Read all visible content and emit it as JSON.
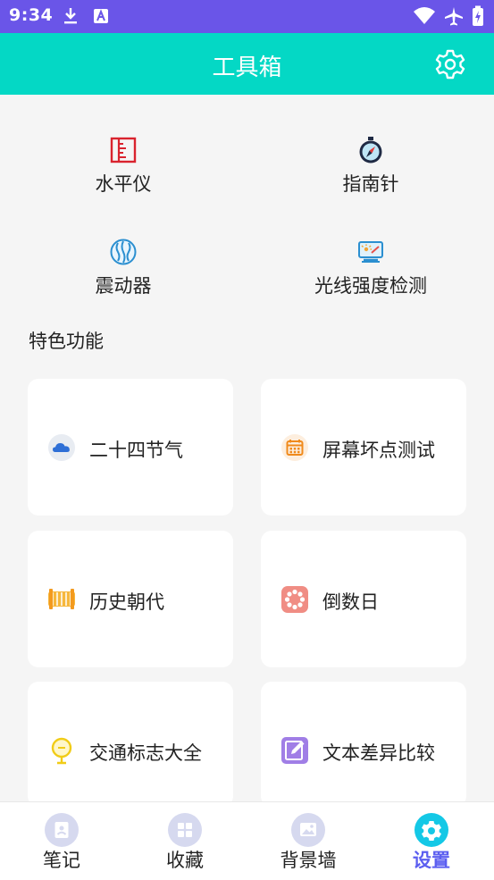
{
  "status_bar": {
    "time": "9:34"
  },
  "app_bar": {
    "title": "工具箱"
  },
  "tools": [
    {
      "label": "水平仪",
      "icon": "ruler-icon"
    },
    {
      "label": "指南针",
      "icon": "compass-icon"
    },
    {
      "label": "震动器",
      "icon": "vibration-icon"
    },
    {
      "label": "光线强度检测",
      "icon": "light-meter-icon"
    }
  ],
  "section": {
    "title": "特色功能"
  },
  "features": [
    {
      "label": "二十四节气",
      "icon": "cloud-icon"
    },
    {
      "label": "屏幕坏点测试",
      "icon": "calendar-grid-icon"
    },
    {
      "label": "历史朝代",
      "icon": "bamboo-scroll-icon"
    },
    {
      "label": "倒数日",
      "icon": "countdown-flower-icon"
    },
    {
      "label": "交通标志大全",
      "icon": "traffic-sign-icon"
    },
    {
      "label": "文本差异比较",
      "icon": "edit-note-icon"
    }
  ],
  "bottom_nav": [
    {
      "label": "笔记",
      "icon": "note-icon",
      "active": false
    },
    {
      "label": "收藏",
      "icon": "grid-icon",
      "active": false
    },
    {
      "label": "背景墙",
      "icon": "image-icon",
      "active": false
    },
    {
      "label": "设置",
      "icon": "gear-icon",
      "active": true
    }
  ],
  "colors": {
    "status_bar": "#6a55e8",
    "app_bar": "#04d8c5",
    "active_nav": "#5b5ef0",
    "background": "#f5f5f5"
  }
}
